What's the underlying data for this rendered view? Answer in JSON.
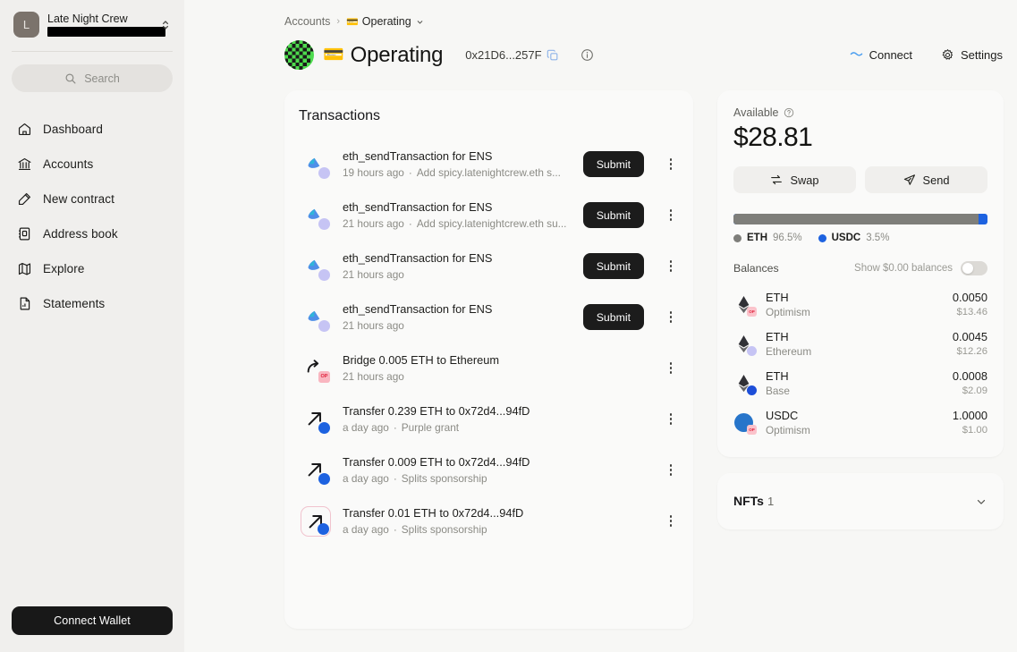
{
  "sidebar": {
    "account": {
      "avatar_initial": "L",
      "name": "Late Night Crew",
      "redacted": true
    },
    "search": {
      "placeholder": "Search",
      "icon": "search-icon"
    },
    "nav_items": [
      {
        "label": "Dashboard",
        "icon": "home-icon"
      },
      {
        "label": "Accounts",
        "icon": "bank-icon"
      },
      {
        "label": "New contract",
        "icon": "pencil-square-icon"
      },
      {
        "label": "Address book",
        "icon": "address-book-icon"
      },
      {
        "label": "Explore",
        "icon": "map-icon"
      },
      {
        "label": "Statements",
        "icon": "document-chart-icon"
      }
    ],
    "connect_wallet_label": "Connect Wallet"
  },
  "header": {
    "breadcrumb": {
      "root": "Accounts",
      "separator": "›",
      "current": "Operating",
      "current_emoji": "💳"
    },
    "account_name": "Operating",
    "account_emoji": "💳",
    "address": "0x21D6...257F",
    "copy_icon": "copy-icon",
    "info_icon": "info-circle-icon",
    "connect_label": "Connect",
    "connect_icon": "walletconnect-icon",
    "settings_label": "Settings",
    "settings_icon": "gear-icon"
  },
  "transactions": {
    "title": "Transactions",
    "submit_label": "Submit",
    "rows": [
      {
        "name": "eth_sendTransaction for ENS",
        "time": "19 hours ago",
        "note": "Add spicy.latenightcrew.eth s...",
        "icon": "ens-icon",
        "badge": "eth",
        "has_submit": true,
        "boxed": false
      },
      {
        "name": "eth_sendTransaction for ENS",
        "time": "21 hours ago",
        "note": "Add spicy.latenightcrew.eth su...",
        "icon": "ens-icon",
        "badge": "eth",
        "has_submit": true,
        "boxed": false
      },
      {
        "name": "eth_sendTransaction for ENS",
        "time": "21 hours ago",
        "note": "",
        "icon": "ens-icon",
        "badge": "eth",
        "has_submit": true,
        "boxed": false
      },
      {
        "name": "eth_sendTransaction for ENS",
        "time": "21 hours ago",
        "note": "",
        "icon": "ens-icon",
        "badge": "eth",
        "has_submit": true,
        "boxed": false
      },
      {
        "name": "Bridge 0.005 ETH to Ethereum",
        "time": "21 hours ago",
        "note": "",
        "icon": "bridge-arrow-icon",
        "badge": "op",
        "has_submit": false,
        "boxed": false
      },
      {
        "name": "Transfer 0.239 ETH to 0x72d4...94fD",
        "time": "a day ago",
        "note": "Purple grant",
        "icon": "send-arrow-icon",
        "badge": "blue",
        "has_submit": false,
        "boxed": false
      },
      {
        "name": "Transfer 0.009 ETH to 0x72d4...94fD",
        "time": "a day ago",
        "note": "Splits sponsorship",
        "icon": "send-arrow-icon",
        "badge": "blue",
        "has_submit": false,
        "boxed": false
      },
      {
        "name": "Transfer 0.01 ETH to 0x72d4...94fD",
        "time": "a day ago",
        "note": "Splits sponsorship",
        "icon": "send-arrow-icon",
        "badge": "blue",
        "has_submit": false,
        "boxed": true
      }
    ]
  },
  "balance_panel": {
    "available_label": "Available",
    "available_icon": "question-circle-icon",
    "amount": "$28.81",
    "swap_label": "Swap",
    "swap_icon": "swap-arrows-icon",
    "send_label": "Send",
    "send_icon": "paper-plane-icon",
    "allocation": [
      {
        "name": "ETH",
        "pct_label": "96.5%",
        "pct": 96.5,
        "color": "#7e7e7a"
      },
      {
        "name": "USDC",
        "pct_label": "3.5%",
        "pct": 3.5,
        "color": "#1d62e0"
      }
    ],
    "balances_label": "Balances",
    "show_zero_label": "Show $0.00 balances",
    "show_zero_on": false,
    "rows": [
      {
        "symbol": "ETH",
        "chain": "Optimism",
        "amount": "0.0050",
        "usd": "$13.46",
        "badge": "op"
      },
      {
        "symbol": "ETH",
        "chain": "Ethereum",
        "amount": "0.0045",
        "usd": "$12.26",
        "badge": "eth"
      },
      {
        "symbol": "ETH",
        "chain": "Base",
        "amount": "0.0008",
        "usd": "$2.09",
        "badge": "base"
      },
      {
        "symbol": "USDC",
        "chain": "Optimism",
        "amount": "1.0000",
        "usd": "$1.00",
        "badge": "op"
      }
    ]
  },
  "nfts": {
    "label": "NFTs",
    "count": "1",
    "chevron_icon": "chevron-down-icon"
  },
  "colors": {
    "accent_blue": "#1d62e0",
    "dark": "#181818",
    "bg": "#f7f7f5",
    "sidebar_bg": "#f0efed"
  }
}
